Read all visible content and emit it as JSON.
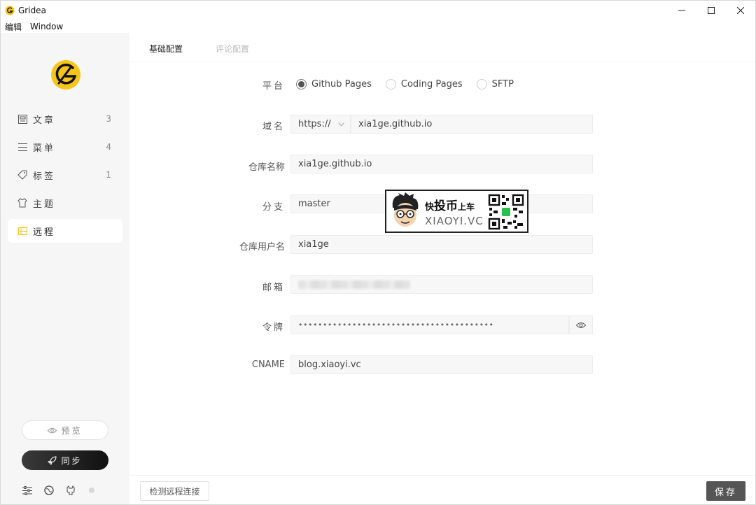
{
  "window": {
    "title": "Gridea",
    "menu": [
      "编辑",
      "Window"
    ],
    "controls": [
      "minimize",
      "maximize",
      "close"
    ]
  },
  "colors": {
    "accent": "#f5c518",
    "sidebar_bg": "#f6f6f6",
    "sync_button": "#1a1a1a",
    "save_button": "#555555"
  },
  "sidebar": {
    "items": [
      {
        "label": "文章",
        "count": "3",
        "icon": "article-icon"
      },
      {
        "label": "菜单",
        "count": "4",
        "icon": "menu-icon"
      },
      {
        "label": "标签",
        "count": "1",
        "icon": "tag-icon"
      },
      {
        "label": "主题",
        "count": "",
        "icon": "theme-shirt-icon"
      },
      {
        "label": "远程",
        "count": "",
        "icon": "remote-icon",
        "active": true
      }
    ],
    "preview_label": "预览",
    "sync_label": "同步",
    "bottom_icons": [
      "settings-sliders-icon",
      "globe-icon",
      "github-icon",
      "status-dot"
    ]
  },
  "tabs": {
    "basic": "基础配置",
    "comment": "评论配置"
  },
  "form": {
    "platform": {
      "label": "平台",
      "options": [
        "Github Pages",
        "Coding Pages",
        "SFTP"
      ],
      "selected": "Github Pages"
    },
    "domain": {
      "label": "域名",
      "protocol": "https://",
      "value": "xia1ge.github.io"
    },
    "repository": {
      "label": "仓库名称",
      "value": "xia1ge.github.io"
    },
    "branch": {
      "label": "分支",
      "value": "master"
    },
    "username": {
      "label": "仓库用户名",
      "value": "xia1ge"
    },
    "email": {
      "label": "邮箱",
      "value": ""
    },
    "token": {
      "label": "令牌",
      "value": "••••••••••••••••••••••••••••••••••••••••"
    },
    "cname": {
      "label": "CNAME",
      "value": "blog.xiaoyi.vc"
    }
  },
  "footer": {
    "check_label": "检测远程连接",
    "save_label": "保存"
  },
  "watermark": {
    "prefix": "快",
    "big": "投币",
    "suffix": "上车",
    "site": "XIAOYI.VC"
  }
}
